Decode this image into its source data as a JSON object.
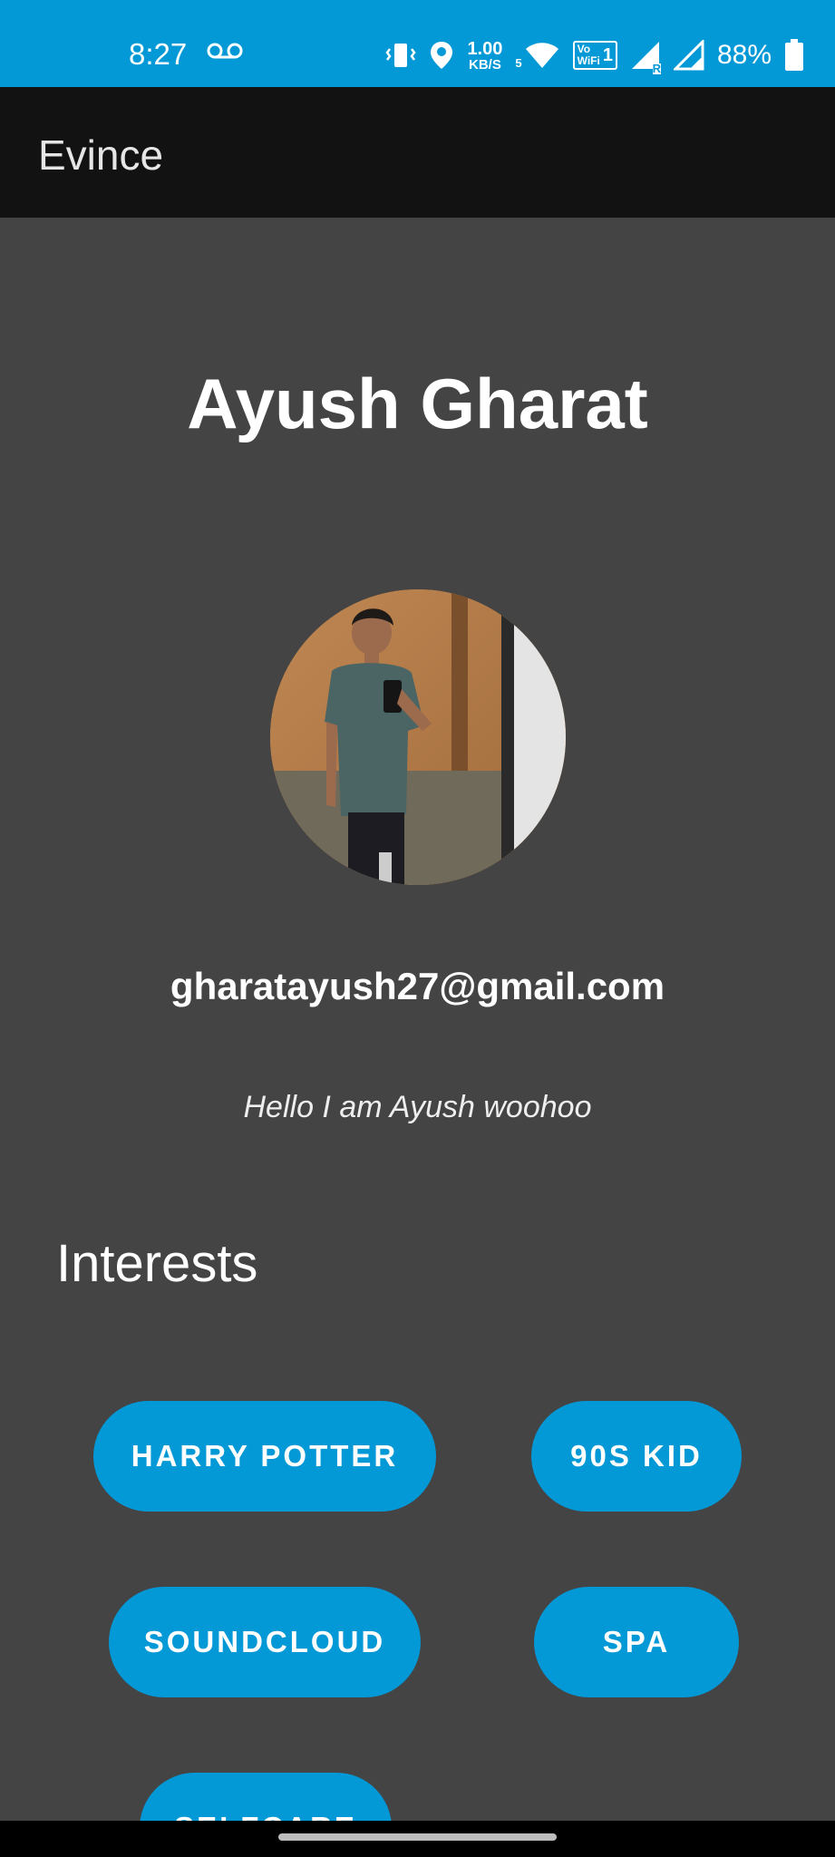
{
  "status_bar": {
    "time": "8:27",
    "net_speed_value": "1.00",
    "net_speed_unit": "KB/S",
    "wifi_sub": "5",
    "vowifi_top": "Vo",
    "vowifi_bottom": "WiFi",
    "vowifi_sim": "1",
    "roaming": "R",
    "battery": "88%",
    "icons": [
      "voicemail-icon",
      "vibrate-icon",
      "location-icon",
      "wifi-icon",
      "vowifi-icon",
      "signal-icon",
      "signal-icon",
      "battery-icon"
    ],
    "background": "#0398d6"
  },
  "app_bar": {
    "title": "Evince",
    "background": "#121212"
  },
  "profile": {
    "name": "Ayush Gharat",
    "email": "gharatayush27@gmail.com",
    "bio": "Hello I am Ayush woohoo"
  },
  "interests": {
    "heading": "Interests",
    "chips": [
      "HARRY POTTER",
      "90S KID",
      "SOUNDCLOUD",
      "SPA",
      "SELFCARE"
    ],
    "chip_color": "#0398d6"
  },
  "colors": {
    "page_background": "#444444",
    "accent": "#0398d6"
  }
}
